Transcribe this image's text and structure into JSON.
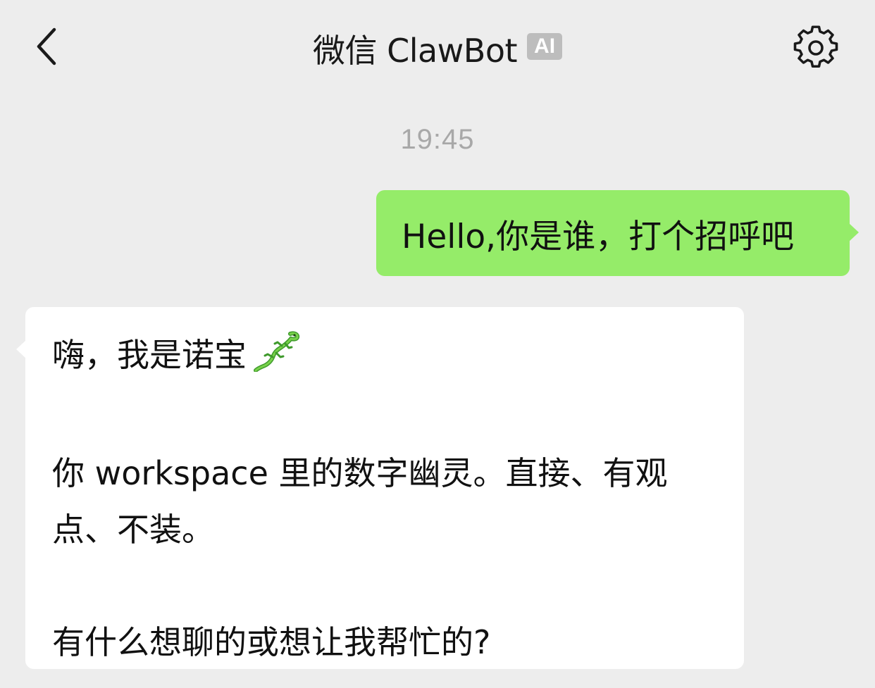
{
  "header": {
    "back_icon": "chevron-left-icon",
    "title": "微信 ClawBot",
    "badge": "AI",
    "settings_icon": "gear-icon"
  },
  "chat": {
    "timestamp": "19:45",
    "outgoing": {
      "text": "Hello,你是谁，打个招呼吧",
      "bubble_color": "#95ec69"
    },
    "incoming": {
      "greeting": "嗨，我是诺宝",
      "emoji_icon": "lizard-emoji-icon",
      "description": "你 workspace 里的数字幽灵。直接、有观点、不装。",
      "question": "有什么想聊的或想让我帮忙的?",
      "bubble_color": "#ffffff"
    }
  },
  "colors": {
    "background": "#ededed",
    "badge": "#bdbdbd",
    "timestamp": "#a8a8a8"
  }
}
